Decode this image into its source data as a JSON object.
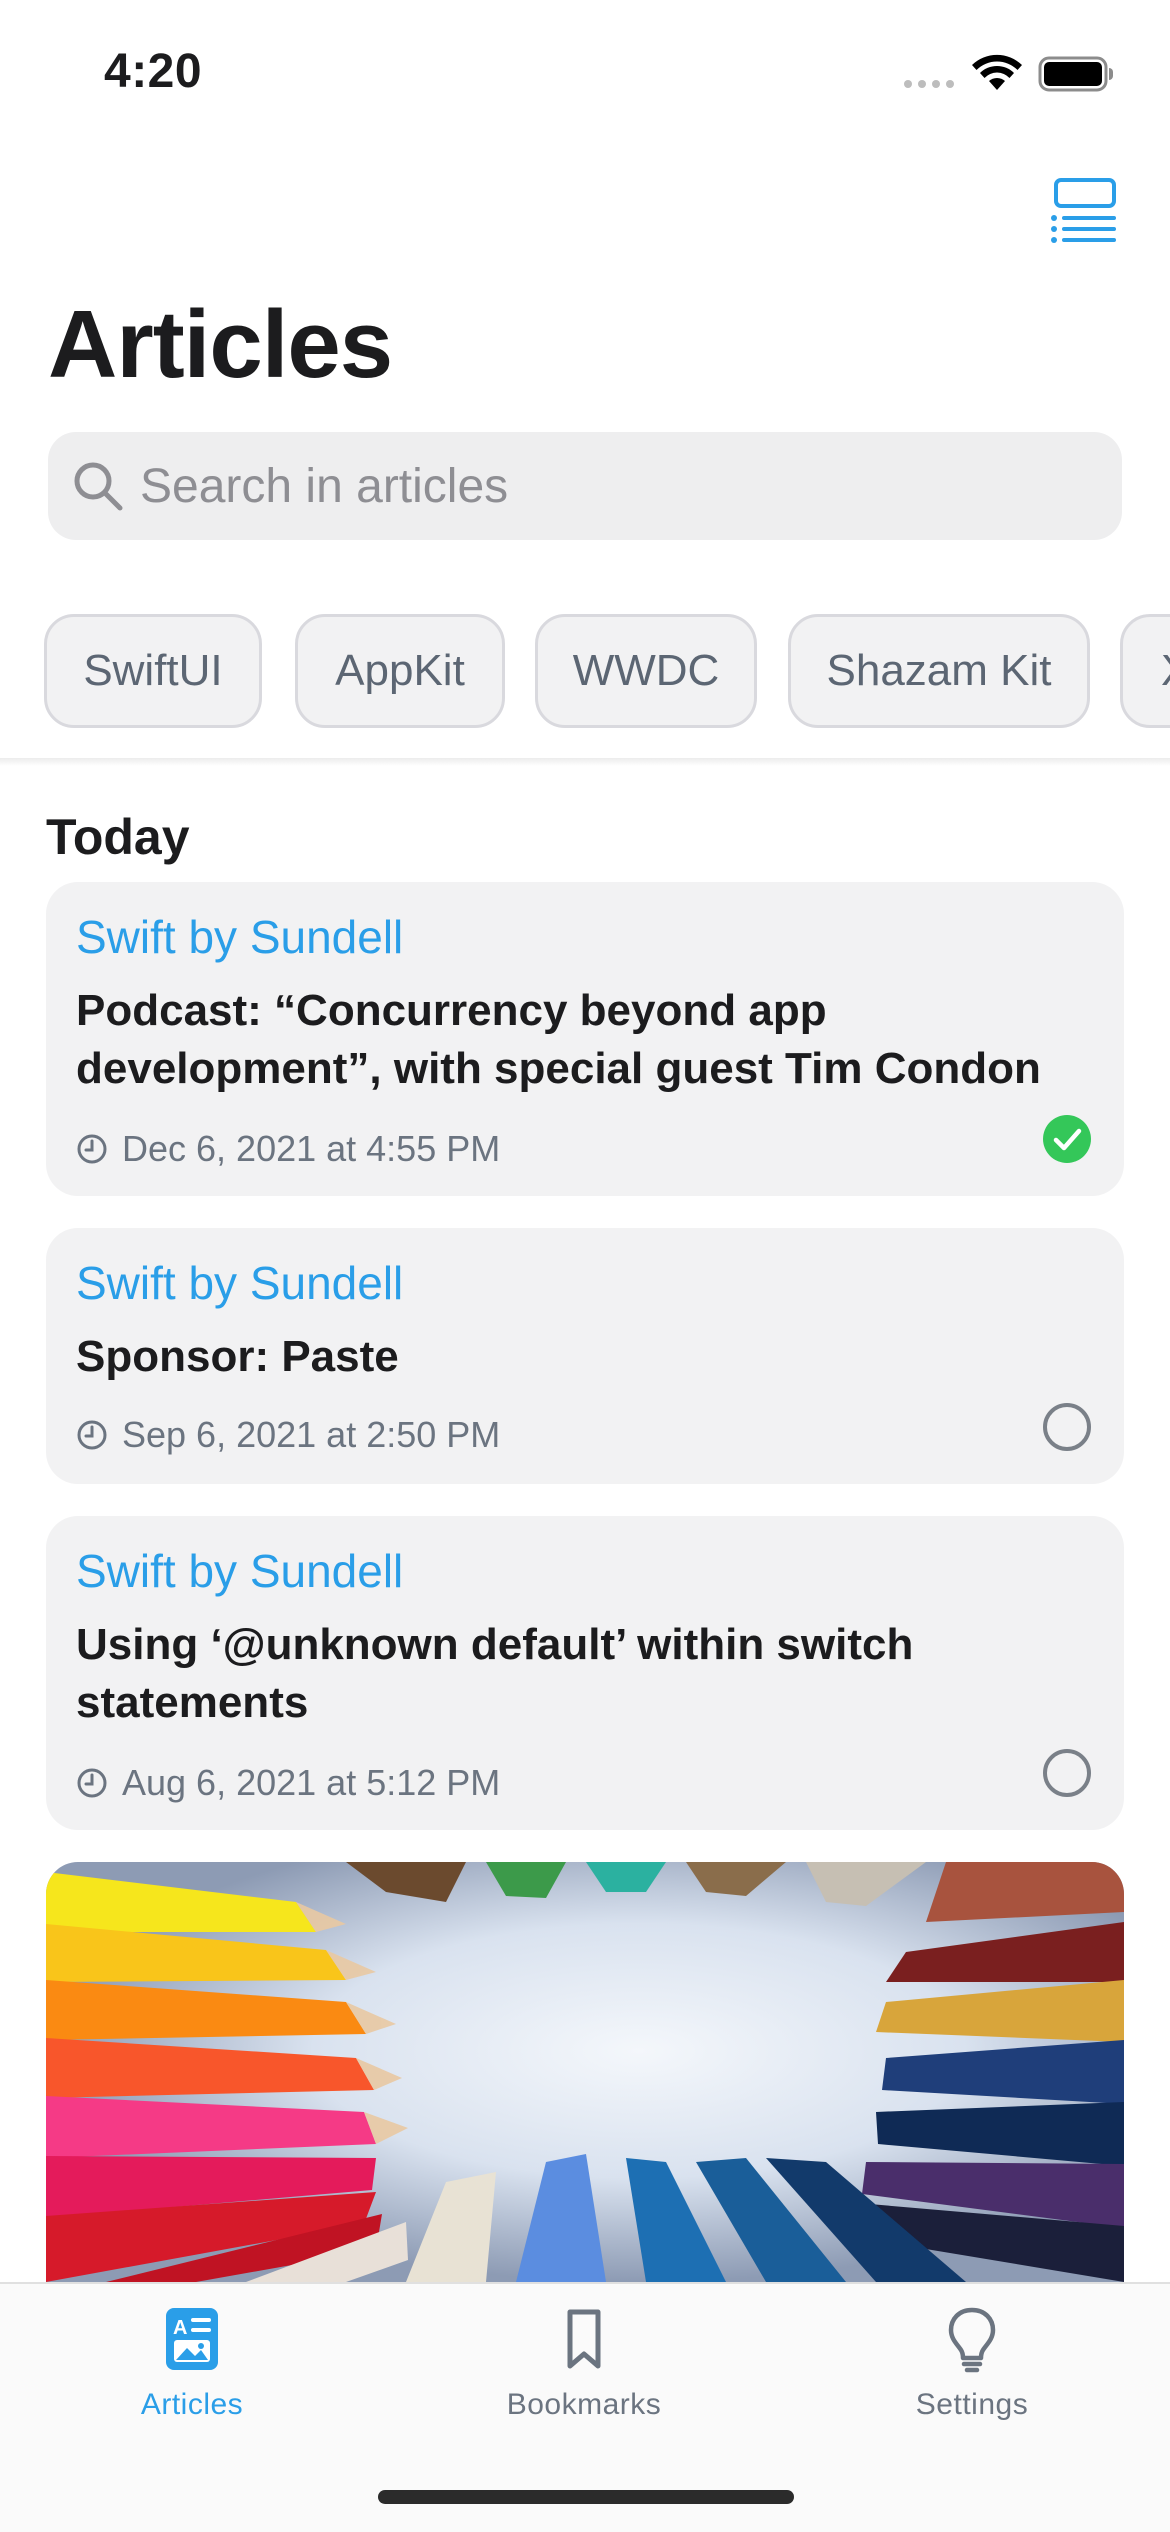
{
  "status_bar": {
    "time": "4:20"
  },
  "nav": {
    "title": "Articles",
    "view_toggle_icon": "list-layout-icon"
  },
  "search": {
    "placeholder": "Search in articles"
  },
  "chips": [
    "SwiftUI",
    "AppKit",
    "WWDC",
    "Shazam Kit",
    "X"
  ],
  "section": {
    "title": "Today"
  },
  "articles": [
    {
      "source": "Swift by Sundell",
      "title": "Podcast: “Concurrency beyond app development”, with special guest Tim Condon",
      "date": "Dec 6, 2021 at 4:55 PM",
      "read": true
    },
    {
      "source": "Swift by Sundell",
      "title": "Sponsor: Paste",
      "date": "Sep 6, 2021 at 2:50 PM",
      "read": false
    },
    {
      "source": "Swift by Sundell",
      "title": "Using ‘@unknown default’ within switch statements",
      "date": "Aug 6, 2021 at 5:12 PM",
      "read": false
    }
  ],
  "tabs": [
    {
      "label": "Articles",
      "icon": "articles-icon",
      "active": true
    },
    {
      "label": "Bookmarks",
      "icon": "bookmark-icon",
      "active": false
    },
    {
      "label": "Settings",
      "icon": "lightbulb-icon",
      "active": false
    }
  ],
  "colors": {
    "accent": "#2a9ee8",
    "read_check": "#34c759",
    "card_bg": "#f2f2f3"
  }
}
